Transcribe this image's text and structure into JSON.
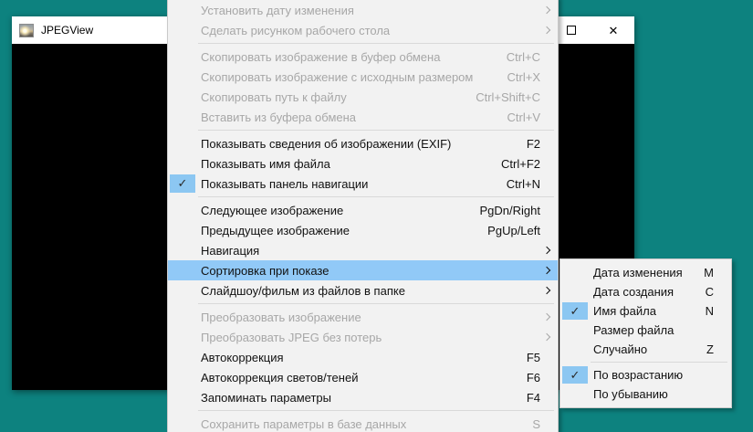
{
  "desktop": {
    "bg_color": "#0d827f"
  },
  "window": {
    "title": "JPEGView",
    "icon": "sunset-photo-thumbnail",
    "controls": {
      "maximize": "maximize-icon",
      "close": "close-icon"
    }
  },
  "icons": {
    "check": "✓",
    "close": "✕",
    "submenu_arrow": "chevron-right"
  },
  "colors": {
    "desktop_bg": "#0d827f",
    "menu_bg": "#f2f2f2",
    "menu_border": "#c9c9c9",
    "highlight": "#91c9f7",
    "check_bg": "#8cc7f2",
    "disabled_text": "#a7a7a7",
    "text": "#111111",
    "separator": "#d9d9d9",
    "titlebar_bg": "#ffffff",
    "content_bg": "#000000"
  },
  "context_menu": {
    "items": [
      {
        "name": "set-modification-date",
        "label": "Установить дату изменения",
        "shortcut": "",
        "disabled": true,
        "submenu": true
      },
      {
        "name": "set-as-desktop-wallpaper",
        "label": "Сделать рисунком рабочего стола",
        "shortcut": "",
        "disabled": true,
        "submenu": true
      },
      {
        "separator": true
      },
      {
        "name": "copy-image-to-clipboard",
        "label": "Скопировать изображение в буфер обмена",
        "shortcut": "Ctrl+C",
        "disabled": true
      },
      {
        "name": "copy-image-original-size",
        "label": "Скопировать изображение с исходным размером",
        "shortcut": "Ctrl+X",
        "disabled": true
      },
      {
        "name": "copy-file-path",
        "label": "Скопировать путь к файлу",
        "shortcut": "Ctrl+Shift+C",
        "disabled": true
      },
      {
        "name": "paste-from-clipboard",
        "label": "Вставить из буфера обмена",
        "shortcut": "Ctrl+V",
        "disabled": true
      },
      {
        "separator": true
      },
      {
        "name": "show-image-info-exif",
        "label": "Показывать сведения об изображении (EXIF)",
        "shortcut": "F2"
      },
      {
        "name": "show-file-name",
        "label": "Показывать имя файла",
        "shortcut": "Ctrl+F2"
      },
      {
        "name": "show-navigation-panel",
        "label": "Показывать панель навигации",
        "shortcut": "Ctrl+N",
        "checked": true
      },
      {
        "separator": true
      },
      {
        "name": "next-image",
        "label": "Следующее изображение",
        "shortcut": "PgDn/Right"
      },
      {
        "name": "previous-image",
        "label": "Предыдущее изображение",
        "shortcut": "PgUp/Left"
      },
      {
        "name": "navigation",
        "label": "Навигация",
        "shortcut": "",
        "submenu": true
      },
      {
        "name": "sort-order",
        "label": "Сортировка при показе",
        "shortcut": "",
        "submenu": true,
        "highlighted": true
      },
      {
        "name": "slideshow-movie-from-folder",
        "label": "Слайдшоу/фильм из файлов в папке",
        "shortcut": "",
        "submenu": true
      },
      {
        "separator": true
      },
      {
        "name": "process-image",
        "label": "Преобразовать изображение",
        "shortcut": "",
        "disabled": true,
        "submenu": true
      },
      {
        "name": "lossless-jpeg-transform",
        "label": "Преобразовать JPEG без потерь",
        "shortcut": "",
        "disabled": true,
        "submenu": true
      },
      {
        "name": "auto-correction",
        "label": "Автокоррекция",
        "shortcut": "F5"
      },
      {
        "name": "auto-correction-highlights-shadows",
        "label": "Автокоррекция светов/теней",
        "shortcut": "F6"
      },
      {
        "name": "remember-parameters",
        "label": "Запоминать параметры",
        "shortcut": "F4"
      },
      {
        "separator": true
      },
      {
        "name": "save-parameters-to-database",
        "label": "Сохранить параметры в базе данных",
        "shortcut": "S",
        "disabled": true
      }
    ]
  },
  "sort_submenu": {
    "items": [
      {
        "name": "sort-by-modification-date",
        "label": "Дата изменения",
        "shortcut": "M"
      },
      {
        "name": "sort-by-creation-date",
        "label": "Дата создания",
        "shortcut": "C"
      },
      {
        "name": "sort-by-file-name",
        "label": "Имя файла",
        "shortcut": "N",
        "checked": true
      },
      {
        "name": "sort-by-file-size",
        "label": "Размер файла",
        "shortcut": ""
      },
      {
        "name": "sort-random",
        "label": "Случайно",
        "shortcut": "Z"
      },
      {
        "separator": true
      },
      {
        "name": "sort-ascending",
        "label": "По возрастанию",
        "shortcut": "",
        "checked": true
      },
      {
        "name": "sort-descending",
        "label": "По убыванию",
        "shortcut": ""
      }
    ]
  }
}
